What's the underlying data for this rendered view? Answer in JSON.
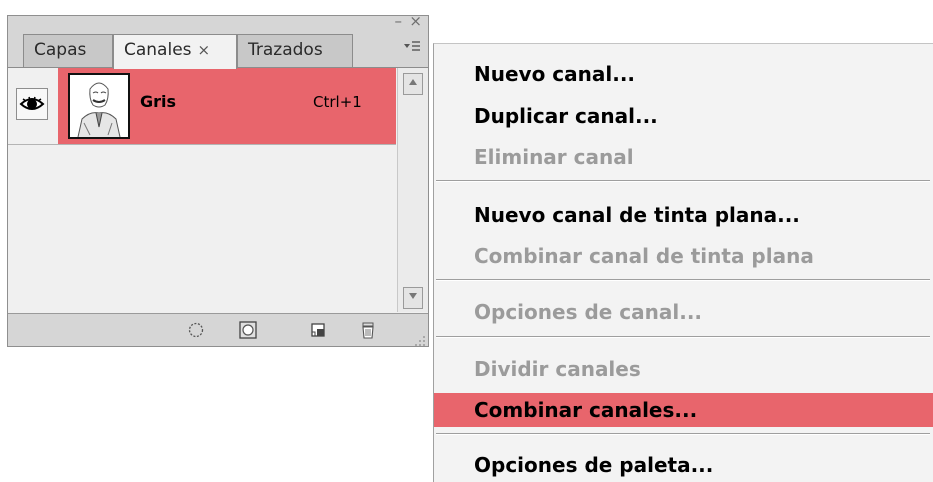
{
  "panel": {
    "tabs": [
      {
        "label": "Capas"
      },
      {
        "label": "Canales",
        "close": "×"
      },
      {
        "label": "Trazados"
      }
    ],
    "window_controls": {
      "minimize": "–",
      "close": "×"
    },
    "menu_button_icon": "panel-menu-icon",
    "channel": {
      "name": "Gris",
      "shortcut": "Ctrl+1",
      "visible": true
    },
    "footer_icons": [
      "load-selection-icon",
      "save-selection-icon",
      "new-channel-icon",
      "trash-icon"
    ]
  },
  "menu": {
    "items": [
      {
        "label": "Nuevo canal...",
        "state": "enabled"
      },
      {
        "label": "Duplicar canal...",
        "state": "enabled"
      },
      {
        "label": "Eliminar canal",
        "state": "disabled"
      },
      {
        "label": "Nuevo canal de tinta plana...",
        "state": "enabled"
      },
      {
        "label": "Combinar canal de tinta plana",
        "state": "disabled"
      },
      {
        "label": "Opciones de canal...",
        "state": "disabled"
      },
      {
        "label": "Dividir canales",
        "state": "disabled"
      },
      {
        "label": "Combinar canales...",
        "state": "active"
      },
      {
        "label": "Opciones de paleta...",
        "state": "enabled"
      }
    ]
  },
  "colors": {
    "highlight": "#e8656c",
    "disabled_text": "#9b9b9b"
  }
}
